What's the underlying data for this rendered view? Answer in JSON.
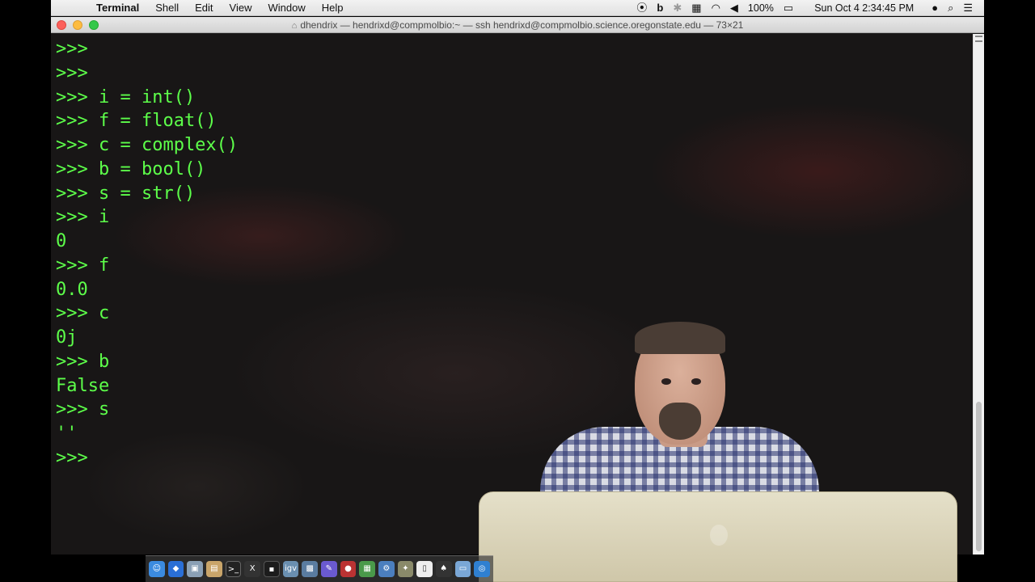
{
  "menubar": {
    "apple_icon": "apple-logo",
    "items": [
      "Terminal",
      "Shell",
      "Edit",
      "View",
      "Window",
      "Help"
    ],
    "status": {
      "battery": "100%",
      "datetime": "Sun Oct 4  2:34:45 PM"
    }
  },
  "window": {
    "title": "dhendrix — hendrixd@compmolbio:~ — ssh hendrixd@compmolbio.science.oregonstate.edu — 73×21"
  },
  "terminal": {
    "text_color": "#5dff4a",
    "lines": [
      ">>>",
      ">>>",
      ">>> i = int()",
      ">>> f = float()",
      ">>> c = complex()",
      ">>> b = bool()",
      ">>> s = str()",
      ">>> i",
      "0",
      ">>> f",
      "0.0",
      ">>> c",
      "0j",
      ">>> b",
      "False",
      ">>> s",
      "''",
      ">>>"
    ]
  },
  "dock": {
    "icons": [
      "finder-icon",
      "dropbox-icon",
      "preview-icon",
      "notes-icon",
      "terminal-icon",
      "x11-icon",
      "console-icon",
      "igv-icon",
      "photo-icon",
      "xcode-icon",
      "molecule-icon",
      "chart-icon",
      "settings-icon",
      "tools-icon",
      "document-icon",
      "game-icon",
      "display-icon",
      "safari-icon"
    ],
    "labels": {
      "igv": "igv"
    }
  }
}
